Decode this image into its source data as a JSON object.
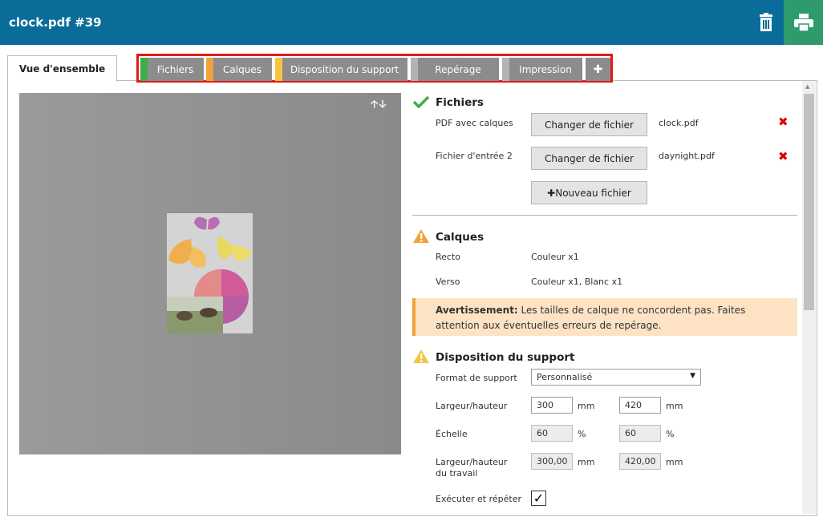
{
  "window": {
    "title": "clock.pdf #39"
  },
  "toolbar": {
    "delete_icon": "trash-icon",
    "print_icon": "printer-icon",
    "print_bg": "#2e9b6d"
  },
  "tabs": {
    "overview": "Vue d'ensemble",
    "items": [
      {
        "label": "Fichiers",
        "status_color": "#3fae49"
      },
      {
        "label": "Calques",
        "status_color": "#f3a23a"
      },
      {
        "label": "Disposition du support",
        "status_color": "#f6c443"
      },
      {
        "label": "Repérage",
        "status_color": "#b3b3b3"
      },
      {
        "label": "Impression",
        "status_color": "#b3b3b3"
      }
    ],
    "add_label": "✚"
  },
  "preview": {
    "arrows": "🡡🡣"
  },
  "files": {
    "title": "Fichiers",
    "status_icon": "checkmark-icon",
    "rows": [
      {
        "label": "PDF avec calques",
        "button": "Changer de fichier",
        "filename": "clock.pdf"
      },
      {
        "label": "Fichier d'entrée 2",
        "button": "Changer de fichier",
        "filename": "daynight.pdf"
      }
    ],
    "new_file_button": "Nouveau fichier",
    "new_file_icon": "✚"
  },
  "layers": {
    "title": "Calques",
    "status_icon": "warning-icon",
    "rows": [
      {
        "label": "Recto",
        "value": "Couleur x1"
      },
      {
        "label": "Verso",
        "value": "Couleur x1, Blanc x1"
      }
    ],
    "warning_bold": "Avertissement:",
    "warning_text": " Les tailles de calque ne concordent pas. Faites attention aux éventuelles erreurs de repérage."
  },
  "media": {
    "title": "Disposition du support",
    "status_icon": "warning-icon",
    "format_label": "Format de support",
    "format_value": "Personnalisé",
    "size_label": "Largeur/hauteur",
    "width": "300",
    "height": "420",
    "unit_mm": "mm",
    "scale_label": "Échelle",
    "scale_x": "60",
    "scale_y": "60",
    "unit_pct": "%",
    "job_size_label_1": "Largeur/hauteur",
    "job_size_label_2": "du travail",
    "job_width": "300,00",
    "job_height": "420,00",
    "step_repeat_label": "Exécuter et répéter",
    "step_repeat_checked": true
  }
}
